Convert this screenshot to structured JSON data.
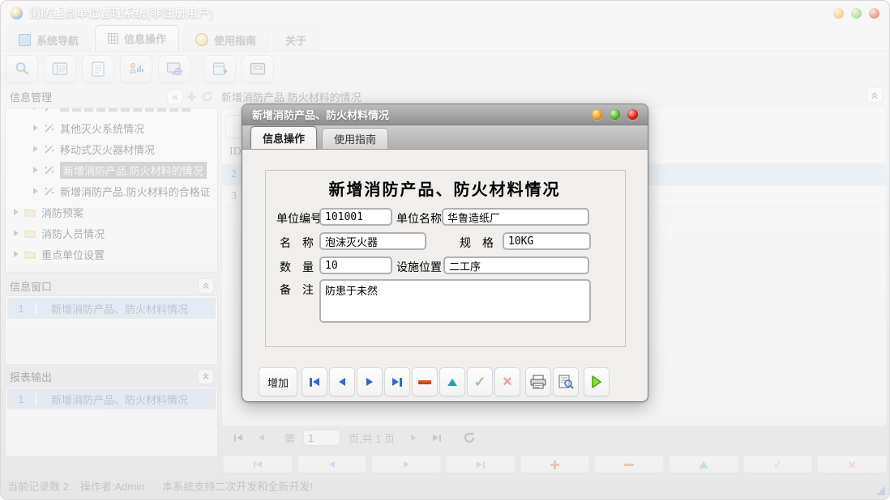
{
  "window": {
    "title": "消防重点单位管理系统(非注册用户)",
    "tabs": [
      {
        "label": "系统导航"
      },
      {
        "label": "信息操作",
        "active": true
      },
      {
        "label": "使用指南"
      },
      {
        "label": "关于"
      }
    ],
    "toolbar_icons": [
      "search",
      "record-details",
      "document",
      "personnel-chart",
      "monitor-view",
      "add-form",
      "archive-drawer"
    ],
    "traffic_lights": [
      "minimize",
      "maximize",
      "close"
    ]
  },
  "sidebar": {
    "info_mgmt": {
      "title": "信息管理",
      "header_icons": [
        "collapse-left",
        "add",
        "refresh"
      ],
      "collapse_glyph": "«",
      "tree": [
        {
          "label": "其他灭火系统情况"
        },
        {
          "label": "移动式灭火器材情况"
        },
        {
          "label": "新增消防产品.防火材料的情况",
          "selected": true
        },
        {
          "label": "新增消防产品.防火材料的合格证"
        },
        {
          "label": "消防预案",
          "icon": "folder"
        },
        {
          "label": "消防人员情况",
          "icon": "folder"
        },
        {
          "label": "重点单位设置",
          "icon": "folder"
        }
      ]
    },
    "info_window": {
      "title": "信息窗口",
      "items": [
        {
          "index": "1",
          "label": "新增消防产品、防火材料情况"
        }
      ]
    },
    "report_output": {
      "title": "报表输出",
      "items": [
        {
          "index": "1",
          "label": "新增消防产品、防火材料情况"
        }
      ]
    }
  },
  "main": {
    "panel_title": "新增消防产品 防火材料的情况",
    "table": {
      "columns": [
        "ID"
      ],
      "rows": [
        {
          "id": "2",
          "selected": true
        },
        {
          "id": "3"
        }
      ]
    },
    "pagination": {
      "prefix": "第",
      "page_value": "1",
      "suffix": "页,共 1 页",
      "icons": [
        "first",
        "prev",
        "next",
        "last",
        "refresh"
      ]
    },
    "action_icons": [
      "first",
      "prev",
      "next",
      "last",
      "add",
      "delete",
      "edit",
      "confirm",
      "cancel"
    ]
  },
  "status_bar": {
    "record_count": "当前记录数 2",
    "operator": "操作者:Admin",
    "message": "本系统支持二次开发和全新开发!"
  },
  "dialog": {
    "title": "新增消防产品、防火材料情况",
    "traffic_lights": [
      "minimize",
      "maximize",
      "close"
    ],
    "tabs": [
      {
        "label": "信息操作",
        "active": true
      },
      {
        "label": "使用指南"
      }
    ],
    "form": {
      "title": "新增消防产品、防火材料情况",
      "fields": [
        {
          "label": "单位编号",
          "value": "101001"
        },
        {
          "label": "单位名称",
          "value": "华鲁造纸厂"
        },
        {
          "label": "名　称",
          "value": "泡沫灭火器"
        },
        {
          "label": "规　格",
          "value": "10KG"
        },
        {
          "label": "数　量",
          "value": "10"
        },
        {
          "label": "设施位置",
          "value": "二工序"
        },
        {
          "label": "备　注",
          "value": "防患于未然"
        }
      ]
    },
    "toolbar": {
      "add_label": "增加",
      "icons": [
        "first",
        "prev",
        "next",
        "last",
        "delete",
        "edit",
        "confirm",
        "cancel",
        "print",
        "preview",
        "run"
      ]
    }
  },
  "colors": {
    "accent_blue": "#2e6bc8",
    "delete_red": "#d8401f",
    "edit_teal": "#2a9cb4",
    "confirm_green": "#8fc98f",
    "cancel_red": "#e59f9f",
    "run_green": "#7ed321",
    "selected_row_bg": "#e4effb",
    "tree_selected_bg": "#b9b9b9"
  }
}
